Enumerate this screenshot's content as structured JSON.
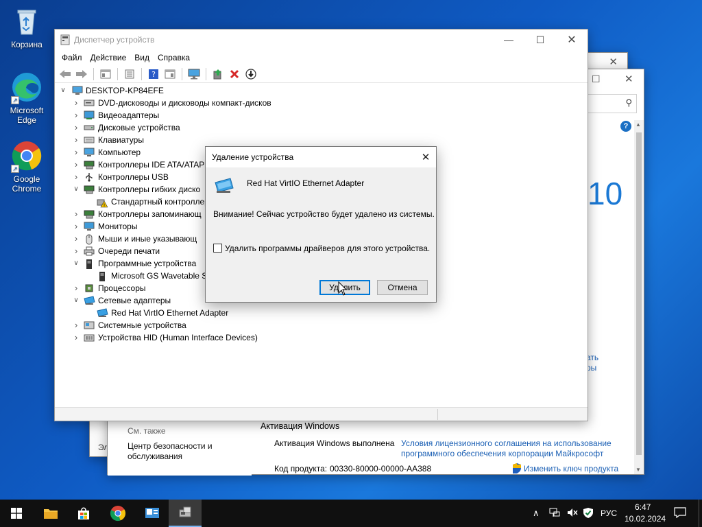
{
  "desktop": {
    "icons": [
      {
        "label": "Корзина"
      },
      {
        "label": "Microsoft Edge"
      },
      {
        "label": "Google Chrome"
      }
    ]
  },
  "system_window": {
    "big_number": "10",
    "side_link_1": "ать",
    "side_link_2": "ры",
    "see_also": "См. также",
    "security_link": "Центр безопасности и обслуживания",
    "activation_title": "Активация Windows",
    "activation_status": "Активация Windows выполнена",
    "license_link": "Условия лицензионного соглашения на использование программного обеспечения корпорации Майкрософт",
    "product_key_label": "Код продукта:",
    "product_key": "00330-80000-00000-AA388",
    "change_key_link": "Изменить ключ продукта",
    "left_fragment": "Эл"
  },
  "device_manager": {
    "title": "Диспетчер устройств",
    "menu": [
      "Файл",
      "Действие",
      "Вид",
      "Справка"
    ],
    "root": "DESKTOP-KP84EFE",
    "items": [
      {
        "label": "DVD-дисководы и дисководы компакт-дисков",
        "expanded": false,
        "level": 1,
        "icon": "dvd-drive-icon"
      },
      {
        "label": "Видеоадаптеры",
        "expanded": false,
        "level": 1,
        "icon": "display-adapter-icon"
      },
      {
        "label": "Дисковые устройства",
        "expanded": false,
        "level": 1,
        "icon": "disk-drive-icon"
      },
      {
        "label": "Клавиатуры",
        "expanded": false,
        "level": 1,
        "icon": "keyboard-icon"
      },
      {
        "label": "Компьютер",
        "expanded": false,
        "level": 1,
        "icon": "computer-icon"
      },
      {
        "label": "Контроллеры IDE ATA/ATAPI",
        "expanded": false,
        "level": 1,
        "icon": "ide-controller-icon"
      },
      {
        "label": "Контроллеры USB",
        "expanded": false,
        "level": 1,
        "icon": "usb-icon"
      },
      {
        "label": "Контроллеры гибких диско",
        "expanded": true,
        "level": 1,
        "icon": "floppy-controller-icon"
      },
      {
        "label": "Стандартный контроллер",
        "level": 2,
        "icon": "warning-device-icon"
      },
      {
        "label": "Контроллеры запоминающ",
        "expanded": false,
        "level": 1,
        "icon": "storage-controller-icon"
      },
      {
        "label": "Мониторы",
        "expanded": false,
        "level": 1,
        "icon": "monitor-icon"
      },
      {
        "label": "Мыши и иные указывающ",
        "expanded": false,
        "level": 1,
        "icon": "mouse-icon"
      },
      {
        "label": "Очереди печати",
        "expanded": false,
        "level": 1,
        "icon": "printer-icon"
      },
      {
        "label": "Программные устройства",
        "expanded": true,
        "level": 1,
        "icon": "software-device-icon"
      },
      {
        "label": "Microsoft GS Wavetable Sy",
        "level": 2,
        "icon": "software-device-icon"
      },
      {
        "label": "Процессоры",
        "expanded": false,
        "level": 1,
        "icon": "processor-icon"
      },
      {
        "label": "Сетевые адаптеры",
        "expanded": true,
        "level": 1,
        "icon": "network-adapter-icon"
      },
      {
        "label": "Red Hat VirtIO Ethernet Adapter",
        "level": 2,
        "icon": "network-adapter-icon"
      },
      {
        "label": "Системные устройства",
        "expanded": false,
        "level": 1,
        "icon": "system-devices-icon"
      },
      {
        "label": "Устройства HID (Human Interface Devices)",
        "expanded": false,
        "level": 1,
        "icon": "hid-icon"
      }
    ]
  },
  "dialog": {
    "title": "Удаление устройства",
    "device_name": "Red Hat VirtIO Ethernet Adapter",
    "warning": "Внимание! Сейчас устройство будет удалено из системы.",
    "checkbox_label": "Удалить программы драйверов для этого устройства.",
    "checkbox_checked": false,
    "ok_label": "Удалить",
    "cancel_label": "Отмена"
  },
  "taskbar": {
    "language": "РУС",
    "time": "6:47",
    "date": "10.02.2024"
  },
  "colors": {
    "accent": "#0078d7",
    "link": "#1a5fb4",
    "taskbar": "#101010"
  }
}
